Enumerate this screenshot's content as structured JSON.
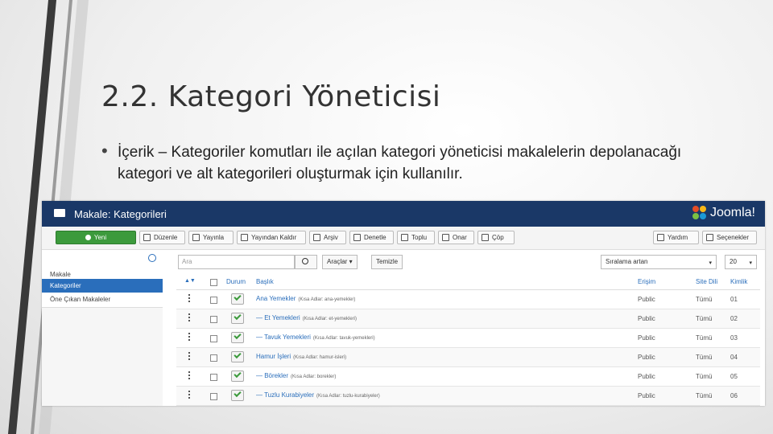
{
  "slide": {
    "title": "2.2. Kategori Yöneticisi",
    "bullet": "İçerik – Kategoriler komutları ile açılan kategori yöneticisi makalelerin depolanacağı kategori ve alt kategorileri oluşturmak için kullanılır."
  },
  "header": {
    "title": "Makale: Kategorileri",
    "logo": "Joomla!"
  },
  "toolbar": {
    "new": "Yeni",
    "edit": "Düzenle",
    "publish": "Yayınla",
    "unpublish": "Yayından Kaldır",
    "archive": "Arşiv",
    "checkin": "Denetle",
    "trash": "Toplu",
    "batch": "Onar",
    "delete": "Çöp",
    "help": "Yardım",
    "options": "Seçenekler"
  },
  "sidebar": {
    "items": [
      "Makale",
      "Kategoriler",
      "Öne Çıkan Makaleler"
    ]
  },
  "filters": {
    "search_placeholder": "Ara",
    "tools": "Araçlar ▾",
    "clear": "Temizle",
    "sort": "Sıralama artan",
    "limit": "20"
  },
  "table": {
    "headers": {
      "status": "Durum",
      "title": "Başlık",
      "access": "Erişim",
      "lang": "Site Dili",
      "id": "Kimlik"
    },
    "rows": [
      {
        "title": "Ana Yemekler",
        "alias": "(Kısa Adlar: ana-yemekler)",
        "access": "Public",
        "lang": "Tümü",
        "id": "01"
      },
      {
        "title": "— Et Yemekleri",
        "alias": "(Kısa Adlar: et-yemekleri)",
        "access": "Public",
        "lang": "Tümü",
        "id": "02"
      },
      {
        "title": "— Tavuk Yemekleri",
        "alias": "(Kısa Adlar: tavuk-yemekleri)",
        "access": "Public",
        "lang": "Tümü",
        "id": "03"
      },
      {
        "title": "Hamur İşleri",
        "alias": "(Kısa Adlar: hamur-isleri)",
        "access": "Public",
        "lang": "Tümü",
        "id": "04"
      },
      {
        "title": "— Börekler",
        "alias": "(Kısa Adlar: borekler)",
        "access": "Public",
        "lang": "Tümü",
        "id": "05"
      },
      {
        "title": "— Tuzlu Kurabiyeler",
        "alias": "(Kısa Adlar: tuzlu-kurabiyeler)",
        "access": "Public",
        "lang": "Tümü",
        "id": "06"
      }
    ]
  }
}
